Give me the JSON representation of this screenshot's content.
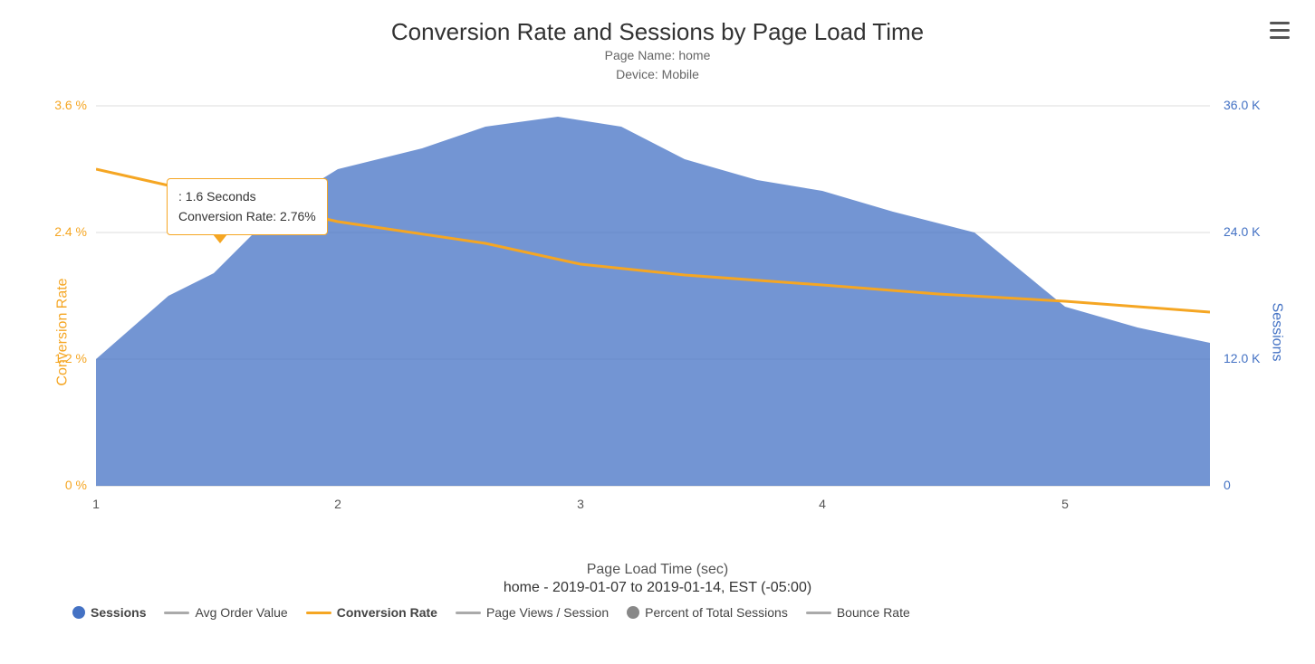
{
  "title": "Conversion Rate and Sessions by Page Load Time",
  "subtitle_line1": "Page Name: home",
  "subtitle_line2": "Device: Mobile",
  "menu_icon_label": "menu",
  "tooltip": {
    "line1": ": 1.6 Seconds",
    "line2": "Conversion Rate: 2.76%"
  },
  "y_axis_left_label": "Conversion Rate",
  "y_axis_right_label": "Sessions",
  "x_axis_label": "Page Load Time (sec)",
  "date_range": "home - 2019-01-07 to 2019-01-14, EST (-05:00)",
  "y_left_ticks": [
    "0 %",
    "1.2 %",
    "2.4 %",
    "3.6 %"
  ],
  "y_right_ticks": [
    "0",
    "12.0 K",
    "24.0 K",
    "36.0 K"
  ],
  "x_ticks": [
    "1",
    "2",
    "3",
    "4",
    "5"
  ],
  "legend": [
    {
      "type": "dot",
      "color": "#4472c4",
      "label": "Sessions",
      "bold": true
    },
    {
      "type": "line",
      "color": "#aaaaaa",
      "label": "Avg Order Value",
      "bold": false
    },
    {
      "type": "line",
      "color": "#f5a623",
      "label": "Conversion Rate",
      "bold": true
    },
    {
      "type": "line",
      "color": "#aaaaaa",
      "label": "Page Views / Session",
      "bold": false
    },
    {
      "type": "dot",
      "color": "#888888",
      "label": "Percent of Total Sessions",
      "bold": false
    },
    {
      "type": "line",
      "color": "#aaaaaa",
      "label": "Bounce Rate",
      "bold": false
    }
  ]
}
